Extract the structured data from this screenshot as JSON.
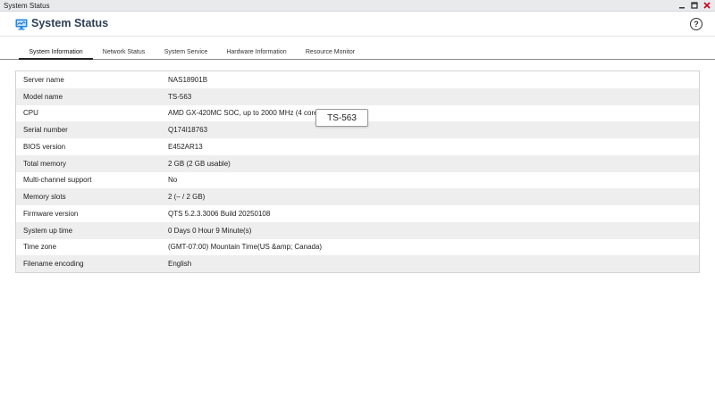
{
  "window": {
    "title": "System Status",
    "controls": [
      "minimize-icon",
      "maximize-icon",
      "close-icon"
    ],
    "close_color": "#d0021b"
  },
  "app": {
    "title": "System Status",
    "icon": "monitor-icon",
    "help_label": "?",
    "title_color": "#2d3f57",
    "accent_color": "#1e88e5"
  },
  "tabs": [
    {
      "label": "System Information",
      "active": true
    },
    {
      "label": "Network Status",
      "active": false
    },
    {
      "label": "System Service",
      "active": false
    },
    {
      "label": "Hardware Information",
      "active": false
    },
    {
      "label": "Resource Monitor",
      "active": false
    }
  ],
  "rows": [
    {
      "label": "Server name",
      "value": "NAS18901B"
    },
    {
      "label": "Model name",
      "value": "TS-563"
    },
    {
      "label": "CPU",
      "value": "AMD GX-420MC SOC, up to 2000 MHz (4 cores"
    },
    {
      "label": "Serial number",
      "value": "Q174I18763"
    },
    {
      "label": "BIOS version",
      "value": "E452AR13"
    },
    {
      "label": "Total memory",
      "value": "2 GB (2 GB usable)"
    },
    {
      "label": "Multi-channel support",
      "value": "No"
    },
    {
      "label": "Memory slots",
      "value": "2 (– / 2 GB)"
    },
    {
      "label": "Firmware version",
      "value": "QTS 5.2.3.3006 Build 20250108"
    },
    {
      "label": "System up time",
      "value": "0 Days 0 Hour 9 Minute(s)"
    },
    {
      "label": "Time zone",
      "value": "(GMT-07:00) Mountain Time(US &amp; Canada)"
    },
    {
      "label": "Filename encoding",
      "value": "English"
    }
  ],
  "tooltip": {
    "text": "TS-563"
  }
}
